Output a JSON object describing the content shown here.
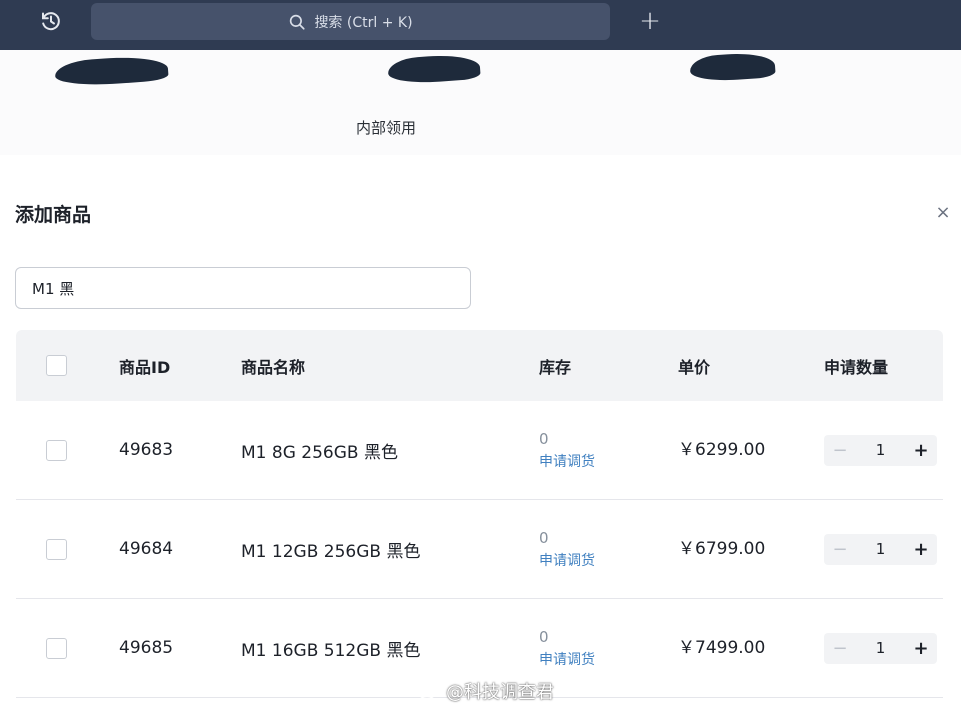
{
  "topbar": {
    "search_placeholder": "搜索 (Ctrl + K)",
    "plus_label": "+"
  },
  "background": {
    "internal_label": "内部领用"
  },
  "modal": {
    "title": "添加商品",
    "close_label": "×",
    "search_value": "M1 黑"
  },
  "table": {
    "headers": {
      "id": "商品ID",
      "name": "商品名称",
      "stock": "库存",
      "price": "单价",
      "qty": "申请数量"
    },
    "rows": [
      {
        "id": "49683",
        "name": "M1 8G 256GB 黑色",
        "stock": "0",
        "apply": "申请调货",
        "price": "￥6299.00",
        "qty": "1"
      },
      {
        "id": "49684",
        "name": "M1 12GB 256GB 黑色",
        "stock": "0",
        "apply": "申请调货",
        "price": "￥6799.00",
        "qty": "1"
      },
      {
        "id": "49685",
        "name": "M1 16GB 512GB 黑色",
        "stock": "0",
        "apply": "申请调货",
        "price": "￥7499.00",
        "qty": "1"
      }
    ],
    "minus_label": "−",
    "plus_label": "+"
  },
  "watermark": {
    "text": "@科技调查君"
  },
  "colors": {
    "topbar": "#2f3b52",
    "link": "#4080c0",
    "header_bg": "#f2f3f5"
  }
}
